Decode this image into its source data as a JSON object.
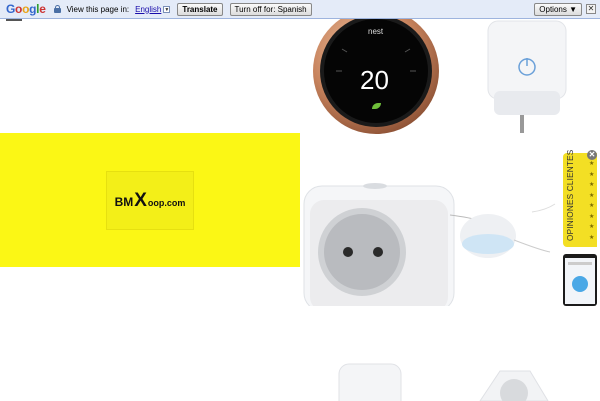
{
  "translate_bar": {
    "brand": "Google",
    "view_label": "View this page in:",
    "language": "English",
    "caret": "▼",
    "translate_button": "Translate",
    "turn_off_button": "Turn off for: Spanish",
    "options_button": "Options ▼",
    "close": "✕"
  },
  "logo": {
    "part1": "BM",
    "part2": "X",
    "part3": "oop.com"
  },
  "thermostat": {
    "brand": "nest",
    "temperature": "20"
  },
  "opinions_tab": {
    "label": "OPINIONES CLIENTES",
    "close": "✕"
  },
  "colors": {
    "yellow_panel": "#fbf715",
    "tab_yellow": "#f3df24",
    "translate_bar_bg": "#e4ebf8"
  }
}
